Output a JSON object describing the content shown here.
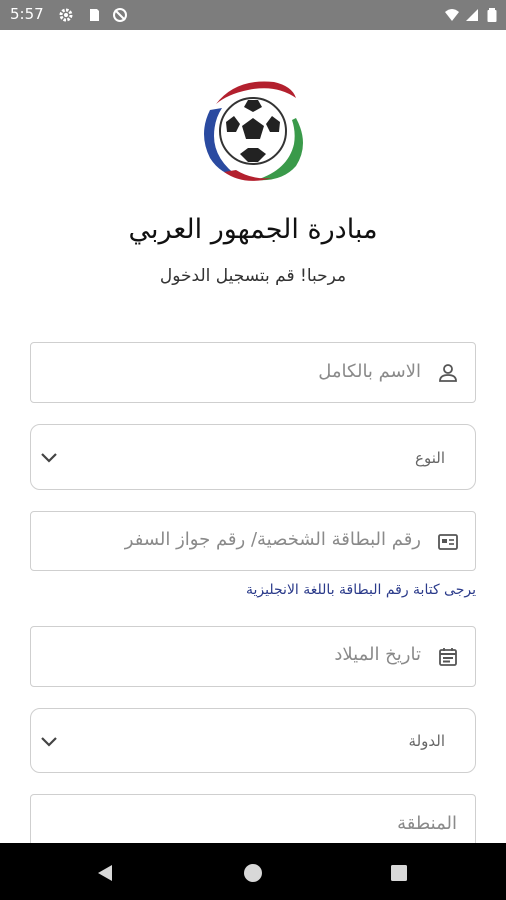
{
  "status_bar": {
    "time": "5:57",
    "left_icons": [
      "gear-icon",
      "sd-card-icon",
      "no-sync-icon"
    ],
    "right_icons": [
      "wifi-icon",
      "signal-icon",
      "battery-icon"
    ]
  },
  "header": {
    "title": "مبادرة الجمهور العربي",
    "subtitle": "مرحبا! قم بتسجيل الدخول"
  },
  "form": {
    "full_name": {
      "placeholder": "الاسم بالكامل",
      "icon": "person-icon"
    },
    "gender": {
      "label": "النوع",
      "icon": "chevron-down-icon"
    },
    "id_number": {
      "placeholder": "رقم البطاقة الشخصية/ رقم جواز السفر",
      "icon": "id-card-icon"
    },
    "id_hint": "يرجى كتابة رقم البطاقة باللغة الانجليزية",
    "birth_date": {
      "placeholder": "تاريخ الميلاد",
      "icon": "calendar-icon"
    },
    "country": {
      "label": "الدولة",
      "icon": "chevron-down-icon"
    },
    "region": {
      "placeholder": "المنطقة"
    }
  },
  "colors": {
    "status_bar": "#7d7d7d",
    "nav_bar": "#000000",
    "hint_text": "#2a3a8a",
    "logo_red": "#b3202e",
    "logo_blue": "#2a4aa0",
    "logo_green": "#3a9a4a"
  },
  "nav_bar": {
    "buttons": [
      "back-icon",
      "home-icon",
      "recents-icon"
    ]
  }
}
